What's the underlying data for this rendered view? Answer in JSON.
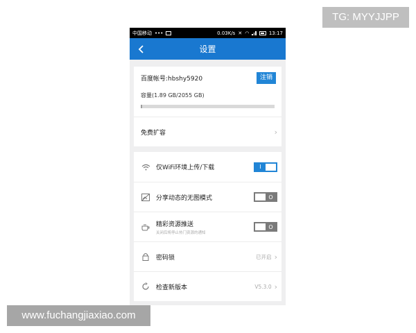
{
  "watermarks": {
    "tg": "TG: MYYJJPP",
    "site": "www.fuchangjiaxiao.com"
  },
  "statusbar": {
    "carrier": "中国移动",
    "dots": "•••",
    "speed": "0.03K/s",
    "time": "13:17"
  },
  "navbar": {
    "title": "设置"
  },
  "account": {
    "label": "百度帐号:hbshy5920",
    "logout_label": "注销"
  },
  "capacity": {
    "label": "容量(1.89 GB/2055 GB)",
    "used_fraction": 0.0009
  },
  "expand": {
    "label": "免费扩容"
  },
  "settings": [
    {
      "label": "仅WiFi环境上传/下载",
      "toggle": "on",
      "toggle_text": "I",
      "icon": "wifi-icon"
    },
    {
      "label": "分享动态的无图模式",
      "toggle": "off",
      "toggle_text": "O",
      "icon": "no-image-icon"
    },
    {
      "label": "精彩资源推送",
      "sublabel": "关闭后将停止热门资源的通知",
      "toggle": "off",
      "toggle_text": "O",
      "icon": "coffee-cup-icon"
    }
  ],
  "lock": {
    "label": "密码锁",
    "status": "已开启"
  },
  "update": {
    "label": "检查新版本",
    "version": "V5.3.0"
  },
  "colors": {
    "navbar": "#1978d0",
    "accent": "#2185d6"
  }
}
